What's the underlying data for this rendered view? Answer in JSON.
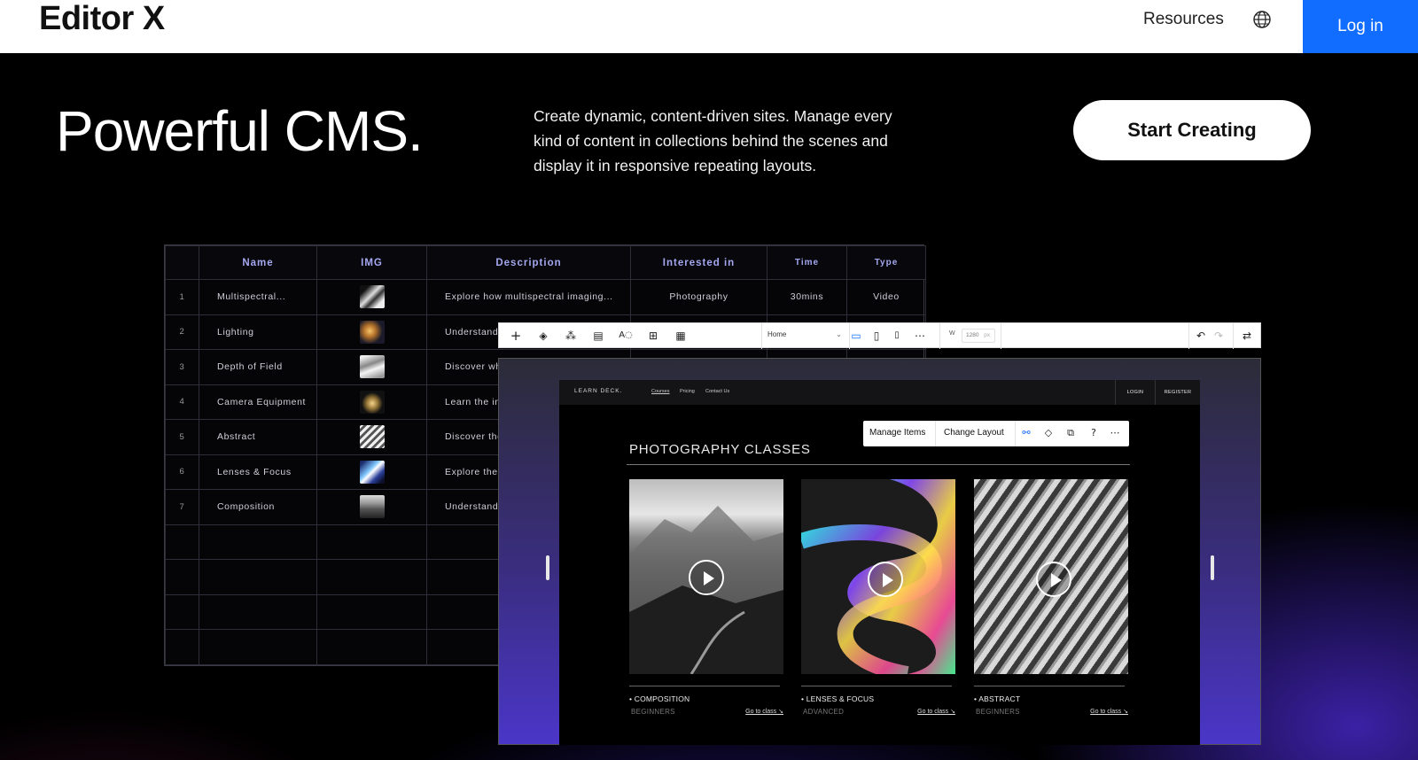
{
  "header": {
    "logo": "Editor X",
    "nav_resources": "Resources",
    "login": "Log in"
  },
  "hero": {
    "title": "Powerful CMS.",
    "description": "Create dynamic, content-driven sites. Manage every kind of content in collections behind the scenes and display it in responsive repeating layouts.",
    "cta": "Start Creating"
  },
  "cms_table": {
    "columns": [
      "Name",
      "IMG",
      "Description",
      "Interested in",
      "Time",
      "Type"
    ],
    "rows": [
      {
        "num": "1",
        "name": "Multispectral...",
        "description": "Explore how multispectral imaging...",
        "interested": "Photography",
        "time": "30mins",
        "type": "Video"
      },
      {
        "num": "2",
        "name": "Lighting",
        "description": "Understand",
        "interested": "",
        "time": "",
        "type": ""
      },
      {
        "num": "3",
        "name": "Depth of Field",
        "description": "Discover wh",
        "interested": "",
        "time": "",
        "type": ""
      },
      {
        "num": "4",
        "name": "Camera Equipment",
        "description": "Learn the ins",
        "interested": "",
        "time": "",
        "type": ""
      },
      {
        "num": "5",
        "name": "Abstract",
        "description": "Discover the",
        "interested": "",
        "time": "",
        "type": ""
      },
      {
        "num": "6",
        "name": "Lenses & Focus",
        "description": "Explore the",
        "interested": "",
        "time": "",
        "type": ""
      },
      {
        "num": "7",
        "name": "Composition",
        "description": "Understand",
        "interested": "",
        "time": "",
        "type": ""
      }
    ]
  },
  "editor_toolbar": {
    "page_select": "Home",
    "width_label": "W",
    "width_value": "1280",
    "width_unit": "px"
  },
  "site": {
    "logo": "LEARN DECK.",
    "links": [
      "Courses",
      "Pricing",
      "Contact Us"
    ],
    "login": "LOGIN",
    "register": "REGISTER",
    "context_bar": {
      "manage_items": "Manage Items",
      "change_layout": "Change Layout"
    },
    "section_title": "PHOTOGRAPHY CLASSES",
    "cards": [
      {
        "name": "COMPOSITION",
        "level": "BEGINNERS",
        "link": "Go to class ↘"
      },
      {
        "name": "LENSES & FOCUS",
        "level": "ADVANCED",
        "link": "Go to class ↘"
      },
      {
        "name": "ABSTRACT",
        "level": "BEGINNERS",
        "link": "Go to class ↘"
      }
    ]
  },
  "colors": {
    "accent_blue": "#116dff",
    "table_header": "#a5a8f0"
  }
}
